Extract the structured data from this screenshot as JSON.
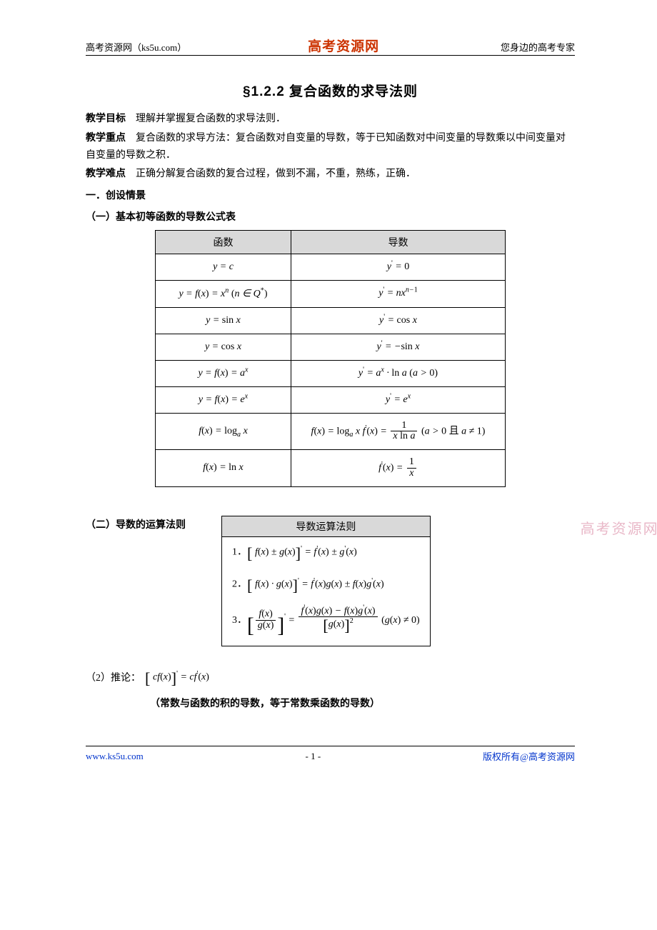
{
  "header": {
    "left": "高考资源网（ks5u.com）",
    "center": "高考资源网",
    "right": "您身边的高考专家"
  },
  "title": "§1.2.2 复合函数的求导法则",
  "goal": {
    "label": "教学目标",
    "text": "理解并掌握复合函数的求导法则．"
  },
  "keypoint": {
    "label": "教学重点",
    "text": "复合函数的求导方法：复合函数对自变量的导数，等于已知函数对中间变量的导数乘以中间变量对自变量的导数之积．"
  },
  "difficulty": {
    "label": "教学难点",
    "text": "正确分解复合函数的复合过程，做到不漏，不重，熟练，正确．"
  },
  "sec1": "一．创设情景",
  "sec1_1": "（一）基本初等函数的导数公式表",
  "table1": {
    "head": [
      "函数",
      "导数"
    ]
  },
  "sec1_2": "（二）导数的运算法则",
  "watermark": "高考资源网",
  "rules_head": "导数运算法则",
  "corollary": {
    "label": "（2）推论：",
    "note": "（常数与函数的积的导数，等于常数乘函数的导数）"
  },
  "footer": {
    "left": "www.ks5u.com",
    "center": "- 1 -",
    "right": "版权所有@高考资源网"
  },
  "chart_data": {
    "type": "table",
    "title": "基本初等函数的导数公式表",
    "columns": [
      "函数",
      "导数"
    ],
    "rows": [
      [
        "y = c",
        "y' = 0"
      ],
      [
        "y = f(x) = x^n (n ∈ Q*)",
        "y' = n x^{n-1}"
      ],
      [
        "y = sin x",
        "y' = cos x"
      ],
      [
        "y = cos x",
        "y' = − sin x"
      ],
      [
        "y = f(x) = a^x",
        "y' = a^x · ln a (a > 0)"
      ],
      [
        "y = f(x) = e^x",
        "y' = e^x"
      ],
      [
        "f(x) = log_a x",
        "f(x) = log_a x  f'(x) = 1 / (x ln a) (a > 0 且 a ≠ 1)"
      ],
      [
        "f(x) = ln x",
        "f'(x) = 1 / x"
      ]
    ],
    "rules": [
      "[f(x) ± g(x)]' = f'(x) ± g'(x)",
      "[f(x) · g(x)]' = f'(x) g(x) ± f(x) g'(x)",
      "[f(x) / g(x)]' = (f'(x) g(x) − f(x) g'(x)) / [g(x)]^2  (g(x) ≠ 0)"
    ],
    "corollary": "[c f(x)]' = c f'(x)"
  }
}
